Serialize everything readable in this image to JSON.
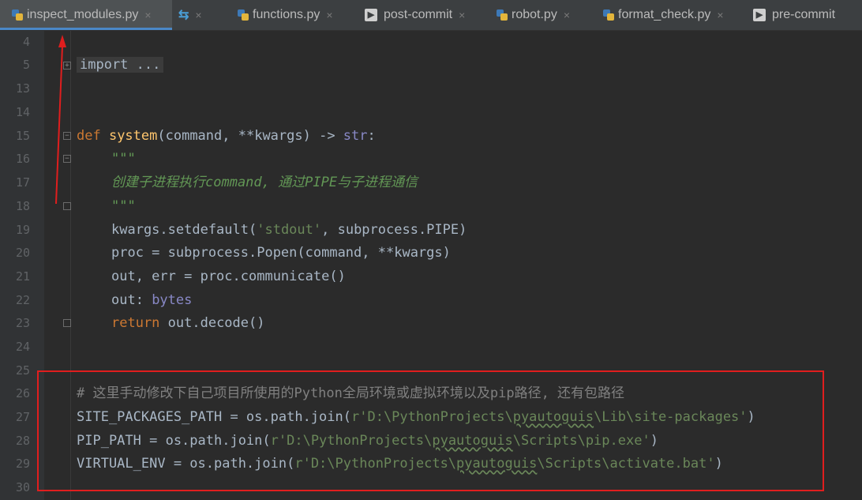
{
  "tabs": [
    {
      "label": "inspect_modules.py",
      "icon": "python-file-icon",
      "active": true
    },
    {
      "label": "",
      "icon": "diff-icon",
      "active": false
    },
    {
      "label": "functions.py",
      "icon": "python-file-icon",
      "active": false
    },
    {
      "label": "post-commit",
      "icon": "terminal-icon",
      "active": false
    },
    {
      "label": "robot.py",
      "icon": "python-file-icon",
      "active": false
    },
    {
      "label": "format_check.py",
      "icon": "python-file-icon",
      "active": false
    },
    {
      "label": "pre-commit",
      "icon": "terminal-icon",
      "active": false
    }
  ],
  "close_glyph": "×",
  "line_numbers": [
    "4",
    "5",
    "13",
    "14",
    "15",
    "16",
    "17",
    "18",
    "19",
    "20",
    "21",
    "22",
    "23",
    "24",
    "25",
    "26",
    "27",
    "28",
    "29",
    "30"
  ],
  "code": {
    "l5_import": "import ...",
    "l15_def": "def ",
    "l15_name": "system",
    "l15_params_a": "(command, ",
    "l15_params_b": "**kwargs) -> ",
    "l15_ret": "str",
    "l15_colon": ":",
    "l16": "\"\"\"",
    "l17": "创建子进程执行command, 通过PIPE与子进程通信",
    "l18": "\"\"\"",
    "l19_a": "kwargs.setdefault(",
    "l19_s": "'stdout'",
    "l19_b": ", subprocess.PIPE)",
    "l20": "proc = subprocess.Popen(command, **kwargs)",
    "l21": "out, err = proc.communicate()",
    "l22_a": "out: ",
    "l22_b": "bytes",
    "l23_kw": "return ",
    "l23_b": "out.decode()",
    "l26": "# 这里手动修改下自己项目所使用的Python全局环境或虚拟环境以及pip路径, 还有包路径",
    "l27_a": "SITE_PACKAGES_PATH = os.path.join(",
    "l27_s1": "r'D:\\PythonProjects\\",
    "l27_sq": "pyautoguis",
    "l27_s2": "\\Lib\\site-packages'",
    "l27_b": ")",
    "l28_a": "PIP_PATH = os.path.join(",
    "l28_s1": "r'D:\\PythonProjects\\",
    "l28_sq": "pyautoguis",
    "l28_s2": "\\Scripts\\pip.exe'",
    "l28_b": ")",
    "l29_a": "VIRTUAL_ENV = os.path.join(",
    "l29_s1": "r'D:\\PythonProjects\\",
    "l29_sq": "pyautoguis",
    "l29_s2": "\\Scripts\\activate.bat'",
    "l29_b": ")"
  },
  "colors": {
    "background": "#2b2b2b",
    "keyword": "#cc7832",
    "function": "#ffc66d",
    "string": "#6a8759",
    "comment": "#808080",
    "annotation_red": "#e01e1e"
  }
}
